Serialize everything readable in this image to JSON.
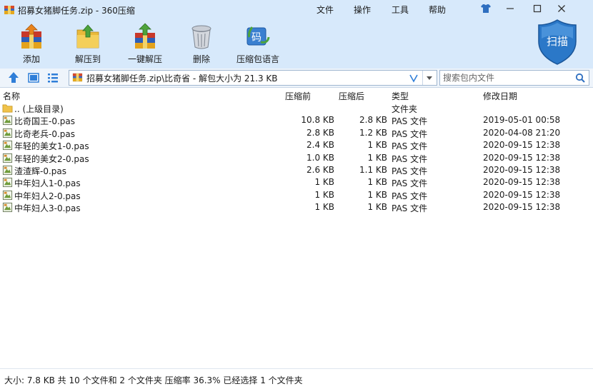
{
  "window": {
    "title": "招募女猪脚任务.zip - 360压缩"
  },
  "menu": {
    "file": "文件",
    "operation": "操作",
    "tools": "工具",
    "help": "帮助"
  },
  "toolbar": {
    "add": "添加",
    "extract_to": "解压到",
    "one_click_extract": "一键解压",
    "delete": "删除",
    "archive_encoding": "压缩包语言",
    "encoding_glyph": "码",
    "scan": "扫描"
  },
  "address": {
    "path": "招募女猪脚任务.zip\\比奇省 - 解包大小为 21.3 KB",
    "search_placeholder": "搜索包内文件"
  },
  "columns": {
    "name": "名称",
    "compressed": "压缩前",
    "packed": "压缩后",
    "type": "类型",
    "modified": "修改日期"
  },
  "rows": [
    {
      "name": ".. (上级目录)",
      "compressed": "",
      "packed": "",
      "type": "文件夹",
      "modified": "",
      "kind": "folder"
    },
    {
      "name": "比奇国王-0.pas",
      "compressed": "10.8 KB",
      "packed": "2.8 KB",
      "type": "PAS 文件",
      "modified": "2019-05-01 00:58",
      "kind": "file"
    },
    {
      "name": "比奇老兵-0.pas",
      "compressed": "2.8 KB",
      "packed": "1.2 KB",
      "type": "PAS 文件",
      "modified": "2020-04-08 21:20",
      "kind": "file"
    },
    {
      "name": "年轻的美女1-0.pas",
      "compressed": "2.4 KB",
      "packed": "1 KB",
      "type": "PAS 文件",
      "modified": "2020-09-15 12:38",
      "kind": "file"
    },
    {
      "name": "年轻的美女2-0.pas",
      "compressed": "1.0 KB",
      "packed": "1 KB",
      "type": "PAS 文件",
      "modified": "2020-09-15 12:38",
      "kind": "file"
    },
    {
      "name": "渣渣辉-0.pas",
      "compressed": "2.6 KB",
      "packed": "1.1 KB",
      "type": "PAS 文件",
      "modified": "2020-09-15 12:38",
      "kind": "file"
    },
    {
      "name": "中年妇人1-0.pas",
      "compressed": "1 KB",
      "packed": "1 KB",
      "type": "PAS 文件",
      "modified": "2020-09-15 12:38",
      "kind": "file"
    },
    {
      "name": "中年妇人2-0.pas",
      "compressed": "1 KB",
      "packed": "1 KB",
      "type": "PAS 文件",
      "modified": "2020-09-15 12:38",
      "kind": "file"
    },
    {
      "name": "中年妇人3-0.pas",
      "compressed": "1 KB",
      "packed": "1 KB",
      "type": "PAS 文件",
      "modified": "2020-09-15 12:38",
      "kind": "file"
    }
  ],
  "status": {
    "text": "大小: 7.8 KB 共 10 个文件和 2 个文件夹 压缩率 36.3% 已经选择 1 个文件夹"
  },
  "colors": {
    "accent": "#1565c0",
    "toolbar_bg": "#d7e9fb",
    "scan_shield": "#2b78c8"
  },
  "icons": [
    "app-archive-icon",
    "shirt-icon",
    "minimize-icon",
    "maximize-icon",
    "close-icon",
    "add-icon",
    "extract-icon",
    "one-click-extract-icon",
    "delete-icon",
    "encoding-icon",
    "scan-shield-icon",
    "up-arrow-icon",
    "view-large-icon",
    "view-list-icon",
    "zip-icon",
    "dropdown-icon",
    "search-icon",
    "folder-icon",
    "pas-file-icon"
  ]
}
